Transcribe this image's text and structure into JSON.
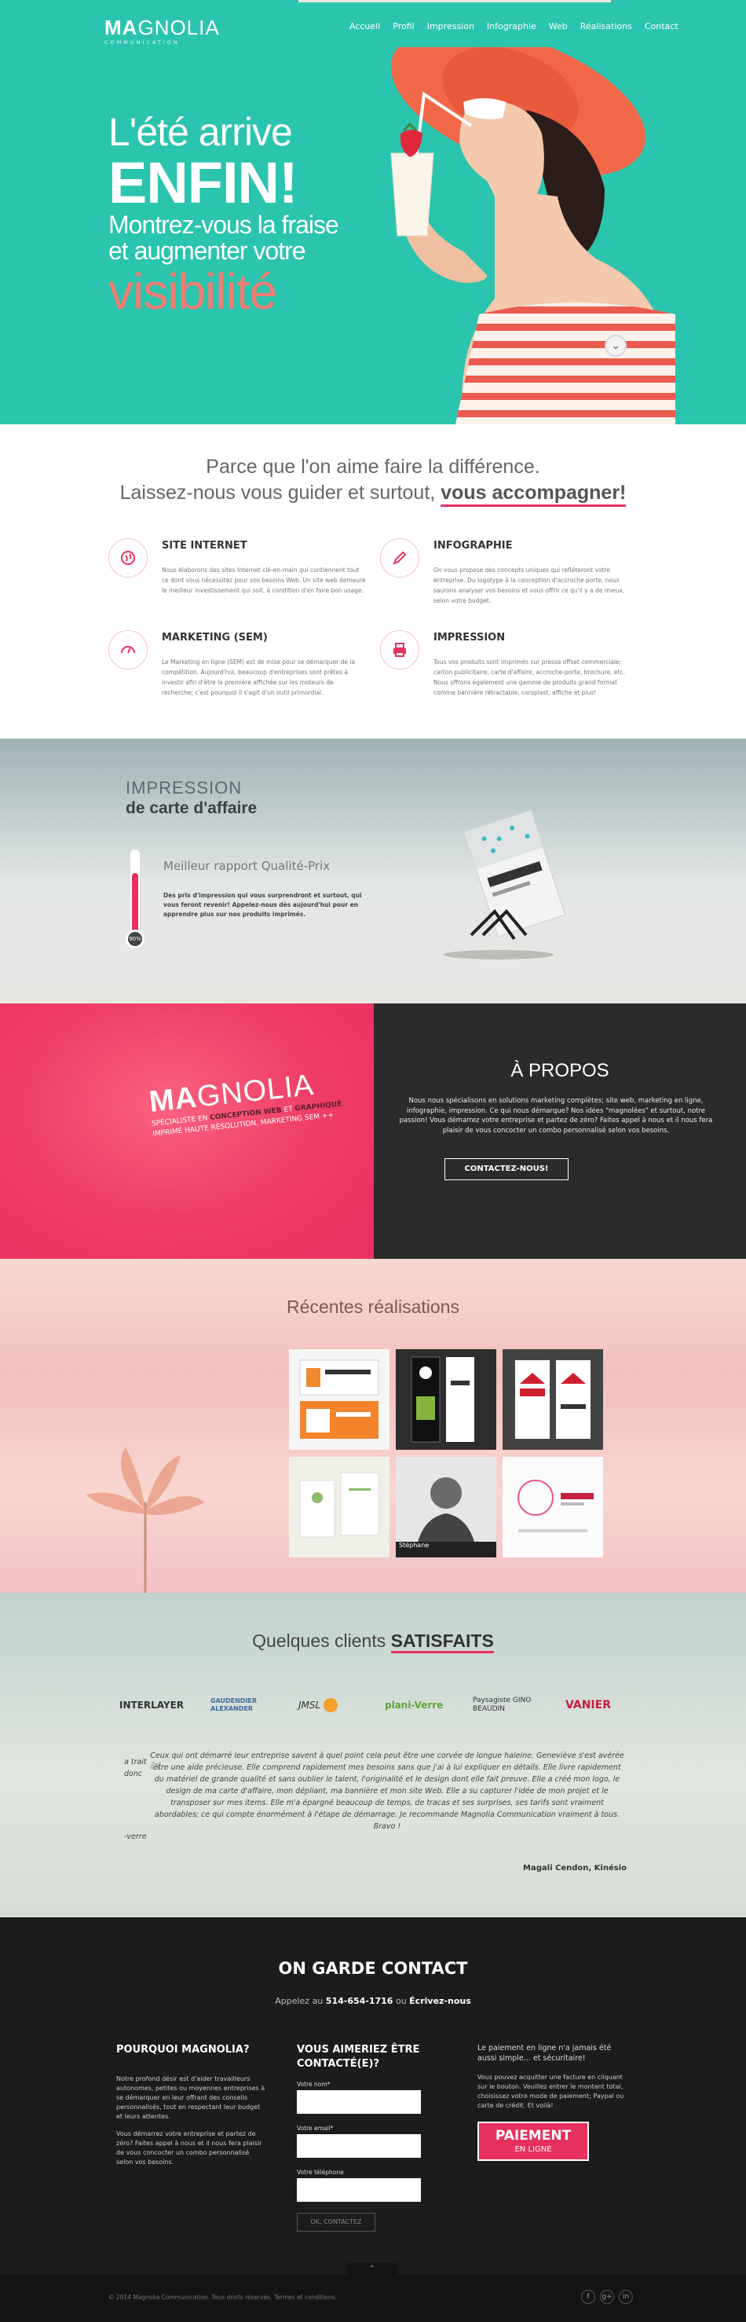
{
  "brand": {
    "logo_strong": "MA",
    "logo_rest": "GNOLIA",
    "logo_sub": "COMMUNICATION"
  },
  "nav": [
    "Accueil",
    "Profil",
    "Impression",
    "Infographie",
    "Web",
    "Réalisations",
    "Contact"
  ],
  "hero": {
    "line1": "L'été arrive",
    "line2": "ENFIN!",
    "line3": "Montrez-vous la fraise",
    "line4": "et augmenter votre",
    "line5": "visibilité"
  },
  "services": {
    "headline1": "Parce que l'on aime faire la différence.",
    "headline2": "Laissez-nous vous guider et surtout,",
    "headline_accent": "vous accompagner!",
    "items": [
      {
        "title": "SITE INTERNET",
        "icon": "globe-icon",
        "desc": "Nous élaborons des sites Internet clé-en-main qui contiennent tout ce dont vous nécessitez pour vos besoins Web. Un site web demeure le meilleur investissement qui soit, à condition d'en faire bon usage."
      },
      {
        "title": "INFOGRAPHIE",
        "icon": "pencil-icon",
        "desc": "On vous propose des concepts uniques qui refléteront votre entreprise. Du logotype à la conception d'accroche porte, nous saurons analyser vos besoins et vous offrir ce qu'il y a de mieux, selon votre budget."
      },
      {
        "title": "MARKETING (SEM)",
        "icon": "gauge-icon",
        "desc": "Le Marketing en ligne (SEM) est de mise pour se démarquer de la compétition. Aujourd'hui, beaucoup d'entreprises sont prêtes à investir afin d'être la première affichée sur les moteurs de recherche; c'est pourquoi il s'agit d'un outil primordial."
      },
      {
        "title": "IMPRESSION",
        "icon": "printer-icon",
        "desc": "Tous vos produits sont imprimés sur presse offset commerciale: carton publicitaire, carte d'affaire, accroche-porte, brochure, etc. Nous offrons également une gamme de produits grand format comme bannière rétractable, coroplast, affiche et plus!"
      }
    ]
  },
  "impression": {
    "title1": "IMPRESSION",
    "title2": "de carte d'affaire",
    "subtitle": "Meilleur rapport Qualité-Prix",
    "desc": "Des prix d'impression qui vous surprendront et surtout, qui vous feront revenir! Appelez-nous dès aujourd'hui pour en apprendre plus sur nos produits imprimés.",
    "gauge_label": "90%",
    "gauge_fraction": 0.9
  },
  "about": {
    "logo_strong": "MA",
    "logo_rest": "GNOLIA",
    "tag1": "SPÉCIALISTE EN",
    "tag2": "CONCEPTION WEB",
    "tag3": "ET",
    "tag4": "GRAPHIQUE",
    "tag5": "IMPRIMÉ HAUTE RÉSOLUTION, MARKETING SEM ++",
    "title": "À PROPOS",
    "text": "Nous nous spécialisons en solutions marketing complètes; site web, marketing en ligne, infographie, impression. Ce qui nous démarque? Nos idées \"magnolées\" et surtout, notre passion! Vous démarrez votre entreprise et partez de zéro? Faites appel à nous et il nous fera plaisir de vous concocter un combo personnalisé selon vos besoins.",
    "button": "CONTACTEZ-NOUS!"
  },
  "portfolio": {
    "title": "Récentes réalisations",
    "caption": "Stéphane"
  },
  "clients": {
    "title_plain": "Quelques clients",
    "title_accent": "SATISFAITS",
    "logos": [
      "INTERLAYER",
      "GAUDENDIER ALEXANDER",
      "JMSL",
      "plani-Verre",
      "Paysagiste GINO BEAUDIN",
      "VANIER"
    ],
    "side1": "a trait",
    "side2": "donc",
    "side3": "-verre",
    "quote": "Ceux qui ont démarré leur entreprise savent à quel point cela peut être une corvée de longue haleine. Geneviève s'est avérée être une aide précieuse. Elle comprend rapidement mes besoins sans que j'ai à lui expliquer en détails. Elle livre rapidement du matériel de grande qualité et sans oublier le talent, l'originalité et le design dont elle fait preuve. Elle a créé mon logo, le design de ma carte d'affaire, mon dépliant, ma bannière et mon site Web. Elle a su capturer l'idée de mon projet et le transposer sur mes items. Elle m'a épargné beaucoup de temps, de tracas et ses surprises, ses tarifs sont vraiment abordables; ce qui compte énormément à l'étape de démarrage. Je recommande Magnolia Communication vraiment à tous. Bravo !",
    "author": "Magali Cendon, Kinésio"
  },
  "contact": {
    "title": "ON GARDE CONTACT",
    "call_prefix": "Appelez au",
    "phone": "514-654-1716",
    "call_mid": "ou",
    "write": "Écrivez-nous",
    "why_title": "POURQUOI MAGNOLIA?",
    "why_p1": "Notre profond désir est d'aider travailleurs autonomes, petites ou moyennes entreprises à se démarquer en leur offrant des conseils personnalisés, tout en respectant leur budget et leurs attentes.",
    "why_p2": "Vous démarrez votre entreprise et partez de zéro? Faites appel à nous et il nous fera plaisir de vous concocter un combo personnalisé selon vos besoins.",
    "form_title": "VOUS AIMERIEZ ÊTRE CONTACTÉ(E)?",
    "name_label": "Votre nom*",
    "email_label": "Votre email*",
    "phone_label": "Votre téléphone",
    "send": "OK, CONTACTEZ",
    "pay_p1": "Le paiement en ligne n'a jamais été aussi simple... et sécuritaire!",
    "pay_p2": "Vous pouvez acquitter une facture en cliquant sur le bouton. Veuillez entrer le montant total, choisissez votre mode de paiement; Paypal ou carte de crédit. Et voilà!",
    "pay_btn1": "PAIEMENT",
    "pay_btn2": "EN LIGNE"
  },
  "footer": {
    "copy": "© 2014 Magnolia Communication. Tous droits réservés. Termes et conditions."
  },
  "colors": {
    "teal": "#2bc4ae",
    "pink": "#e8305f",
    "coral": "#f07e74",
    "dark": "#1c1c1d"
  }
}
